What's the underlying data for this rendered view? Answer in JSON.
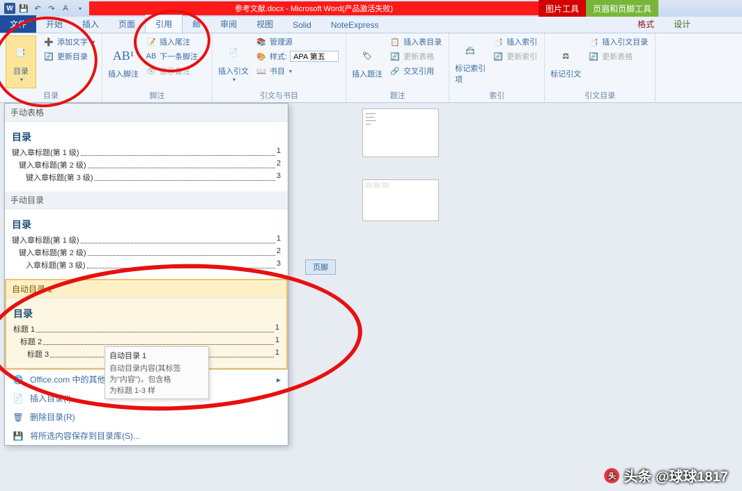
{
  "titlebar": {
    "doc_title": "参考文献.docx - Microsoft Word(产品激活失败)"
  },
  "context_tabs": {
    "picture": "图片工具",
    "headerfooter": "页眉和页脚工具"
  },
  "tabs": {
    "file": "文件",
    "home": "开始",
    "insert": "插入",
    "layout": "页面",
    "references": "引用",
    "mail": "邮",
    "review": "审阅",
    "view": "视图",
    "solid": "Solid",
    "noteexpress": "NoteExpress",
    "format": "格式",
    "design": "设计"
  },
  "ribbon": {
    "toc": {
      "label": "目录",
      "add_text": "添加文字",
      "update": "更新目录",
      "group": "目录"
    },
    "footnote": {
      "label": "插入脚注",
      "big": "AB¹",
      "insert_endnote": "插入尾注",
      "next": "下一条脚注",
      "show": "显示备注",
      "group": "脚注"
    },
    "citation": {
      "label": "插入引文",
      "manage": "管理源",
      "style": "样式:",
      "style_val": "APA 第五",
      "biblio": "书目",
      "group": "引文与书目"
    },
    "caption": {
      "label": "插入题注",
      "insert_tof": "插入表目录",
      "update_tof": "更新表格",
      "crossref": "交叉引用",
      "group": "题注"
    },
    "index_entry": {
      "label": "标记索引项",
      "insert": "插入索引",
      "update": "更新索引",
      "group": "索引"
    },
    "toa": {
      "label": "标记引文",
      "insert": "插入引文目录",
      "update": "更新表格",
      "group": "引文目录"
    }
  },
  "toc_panel": {
    "manual_table": "手动表格",
    "toc_heading": "目录",
    "l1": "键入章标题(第 1 级)",
    "p1": "1",
    "l2": "键入章标题(第 2 级)",
    "p2": "2",
    "l3": "键入章标题(第 3 级)",
    "p3": "3",
    "manual_toc": "手动目录",
    "m1": "键入章标题(第 1 级)",
    "mp1": "1",
    "m2": "键入章标题(第 2 级)",
    "mp2": "2",
    "m3": "入章标题(第 3 级)",
    "mp3": "3",
    "auto1": "自动目录 1",
    "a1": "标题 1",
    "ap1": "1",
    "a2": "标题 2",
    "ap2": "1",
    "a3": "标题 3",
    "ap3": "1",
    "menu_office": "Office.com 中的其他目录(M)",
    "menu_insert": "插入目录(I)...",
    "menu_remove": "删除目录(R)",
    "menu_save": "将所选内容保存到目录库(S)..."
  },
  "tooltip": {
    "title": "自动目录 1",
    "line1": "自动目录内容(其标签",
    "line2": "为\"内容\")，包含格",
    "line3": "为标题 1-3 样"
  },
  "footer_tag": "页脚",
  "watermark": "头条 @球球1817"
}
